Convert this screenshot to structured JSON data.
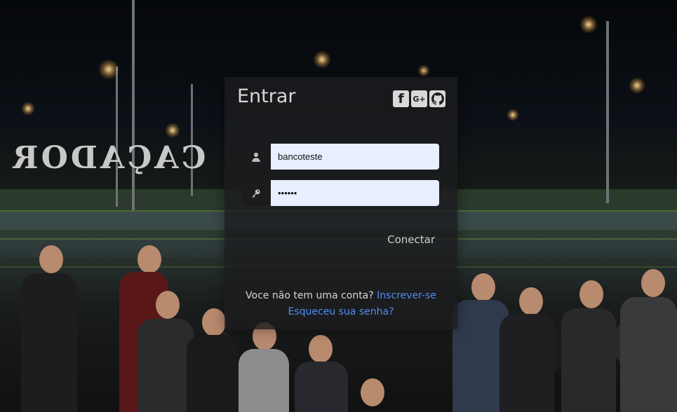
{
  "login": {
    "title": "Entrar",
    "social": {
      "facebook_glyph": "f",
      "google_glyph": "G+",
      "github_icon": "github-icon"
    },
    "username": {
      "value": "bancoteste",
      "icon": "user-icon"
    },
    "password": {
      "value": "••••••",
      "icon": "key-icon"
    },
    "connect_label": "Conectar",
    "no_account_text": "Voce não tem uma conta?",
    "signup_link": "Inscrever-se",
    "forgot_link": "Esqueceu sua senha?"
  },
  "colors": {
    "link": "#4f8df0",
    "input_bg": "#e8efff",
    "panel_bg": "#1c1c1e"
  }
}
